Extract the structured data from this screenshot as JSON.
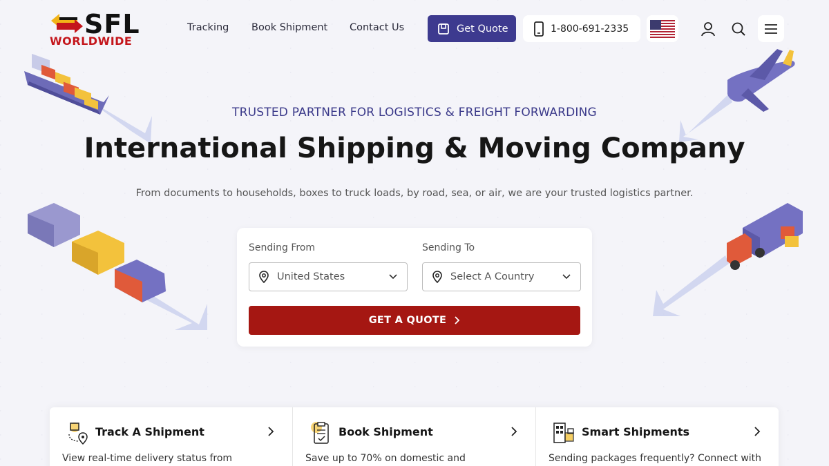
{
  "brand": {
    "name_top": "SFL",
    "name_bottom": "WORLDWIDE",
    "accent": "#c4161c",
    "primary": "#3d3a8f"
  },
  "nav": {
    "links": [
      "Tracking",
      "Book Shipment",
      "Contact Us"
    ],
    "quote_label": "Get Quote",
    "phone": "1-800-691-2335",
    "flag_icon": "us-flag-icon",
    "icons": [
      "user-icon",
      "search-icon",
      "menu-icon"
    ]
  },
  "hero": {
    "tagline": "TRUSTED PARTNER FOR LOGISTICS & FREIGHT FORWARDING",
    "title": "International Shipping & Moving Company",
    "subtitle": "From documents to households, boxes to truck loads, by road, sea, or air, we are your trusted logistics partner."
  },
  "quote_form": {
    "from_label": "Sending From",
    "from_value": "United States",
    "to_label": "Sending To",
    "to_value": "Select A Country",
    "submit_label": "GET A QUOTE",
    "submit_color": "#a51712"
  },
  "features": [
    {
      "title": "Track A Shipment",
      "desc": "View real-time delivery status from",
      "icon": "track-shipment-icon"
    },
    {
      "title": "Book Shipment",
      "desc": "Save up to 70% on domestic and",
      "icon": "book-shipment-icon"
    },
    {
      "title": "Smart Shipments",
      "desc": "Sending packages frequently? Connect with",
      "icon": "smart-shipments-icon"
    }
  ]
}
